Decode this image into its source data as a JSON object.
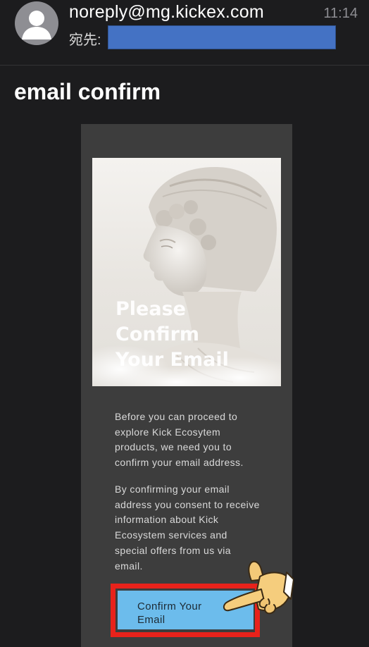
{
  "header": {
    "sender": "noreply@mg.kickex.com",
    "time": "11:14",
    "to_label": "宛先:"
  },
  "subject": "email confirm",
  "email": {
    "hero_title_lines": [
      "Please",
      "Confirm",
      "Your Email"
    ],
    "paragraph_1": "Before you can proceed to explore Kick Ecosytem products, we need you to confirm your email address.",
    "paragraph_2": "By confirming your email address you consent to receive information about Kick Ecosystem services and special offers from us via email.",
    "button_lines": [
      "Confirm Your",
      "Email"
    ]
  },
  "colors": {
    "background": "#1c1c1e",
    "card": "#3d3d3d",
    "button": "#6cbcec",
    "highlight": "#e8221b",
    "redaction": "#4472c4"
  }
}
